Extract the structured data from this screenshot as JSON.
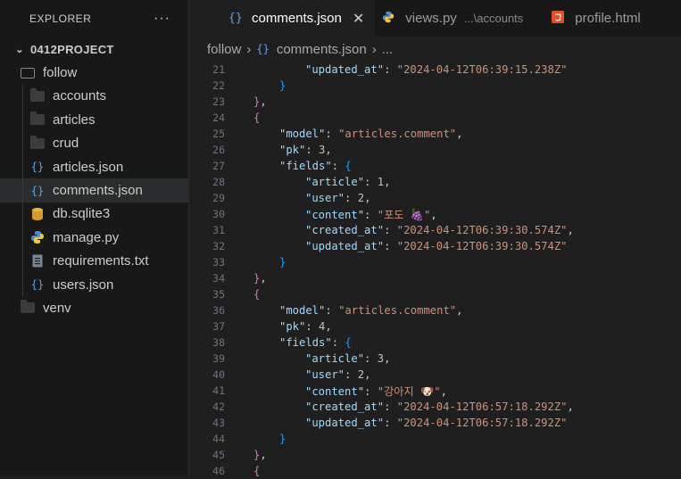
{
  "explorer": {
    "title": "EXPLORER",
    "more": "···",
    "root": "0412PROJECT",
    "items": [
      {
        "label": "follow",
        "type": "folder-open"
      },
      {
        "label": "accounts",
        "type": "folder"
      },
      {
        "label": "articles",
        "type": "folder"
      },
      {
        "label": "crud",
        "type": "folder"
      },
      {
        "label": "articles.json",
        "type": "json"
      },
      {
        "label": "comments.json",
        "type": "json"
      },
      {
        "label": "db.sqlite3",
        "type": "database"
      },
      {
        "label": "manage.py",
        "type": "python"
      },
      {
        "label": "requirements.txt",
        "type": "text"
      },
      {
        "label": "users.json",
        "type": "json"
      },
      {
        "label": "venv",
        "type": "folder"
      }
    ]
  },
  "tabs": [
    {
      "label": "comments.json",
      "icon": "{·}",
      "active": true,
      "close": "✕"
    },
    {
      "label": "views.py",
      "description": "...\\accounts",
      "icon": "python-icon"
    },
    {
      "label": "profile.html",
      "icon": "html-icon"
    }
  ],
  "breadcrumb": {
    "folder": "follow",
    "file": "comments.json",
    "json_icon": "{·}",
    "more": "..."
  },
  "colors": {
    "key": "#9cdcfe",
    "string": "#ce9178",
    "number": "#b5cea8",
    "selected_row": "#2a2d2e"
  },
  "editor": {
    "lines": [
      {
        "n": "21",
        "t": ""
      },
      {
        "n": "22",
        "t": ""
      },
      {
        "n": "23",
        "t": ""
      },
      {
        "n": "24",
        "t": ""
      },
      {
        "n": "25",
        "t": ""
      },
      {
        "n": "26",
        "t": ""
      },
      {
        "n": "27",
        "t": ""
      },
      {
        "n": "28",
        "t": ""
      },
      {
        "n": "29",
        "t": ""
      },
      {
        "n": "30",
        "t": ""
      },
      {
        "n": "31",
        "t": ""
      },
      {
        "n": "32",
        "t": ""
      },
      {
        "n": "33",
        "t": ""
      },
      {
        "n": "34",
        "t": ""
      },
      {
        "n": "35",
        "t": ""
      },
      {
        "n": "36",
        "t": ""
      },
      {
        "n": "37",
        "t": ""
      },
      {
        "n": "38",
        "t": ""
      },
      {
        "n": "39",
        "t": ""
      },
      {
        "n": "40",
        "t": ""
      },
      {
        "n": "41",
        "t": ""
      },
      {
        "n": "42",
        "t": ""
      },
      {
        "n": "43",
        "t": ""
      },
      {
        "n": "44",
        "t": ""
      },
      {
        "n": "45",
        "t": ""
      },
      {
        "n": "46",
        "t": ""
      }
    ],
    "code": {
      "updated_1": "\"2024-04-12T06:39:15.238Z\"",
      "model_2": "\"articles.comment\"",
      "pk_2": "3",
      "article_2": "1",
      "user_2": "2",
      "content_2": "\"포도 🍇\"",
      "created_2": "\"2024-04-12T06:39:30.574Z\"",
      "updated_2": "\"2024-04-12T06:39:30.574Z\"",
      "model_3": "\"articles.comment\"",
      "pk_3": "4",
      "article_3": "3",
      "user_3": "2",
      "content_3": "\"강아지 🐶\"",
      "created_3": "\"2024-04-12T06:57:18.292Z\"",
      "updated_3": "\"2024-04-12T06:57:18.292Z\""
    },
    "keys": {
      "model": "\"model\"",
      "pk": "\"pk\"",
      "fields": "\"fields\"",
      "article": "\"article\"",
      "user": "\"user\"",
      "content": "\"content\"",
      "created_at": "\"created_at\"",
      "updated_at": "\"updated_at\""
    }
  }
}
